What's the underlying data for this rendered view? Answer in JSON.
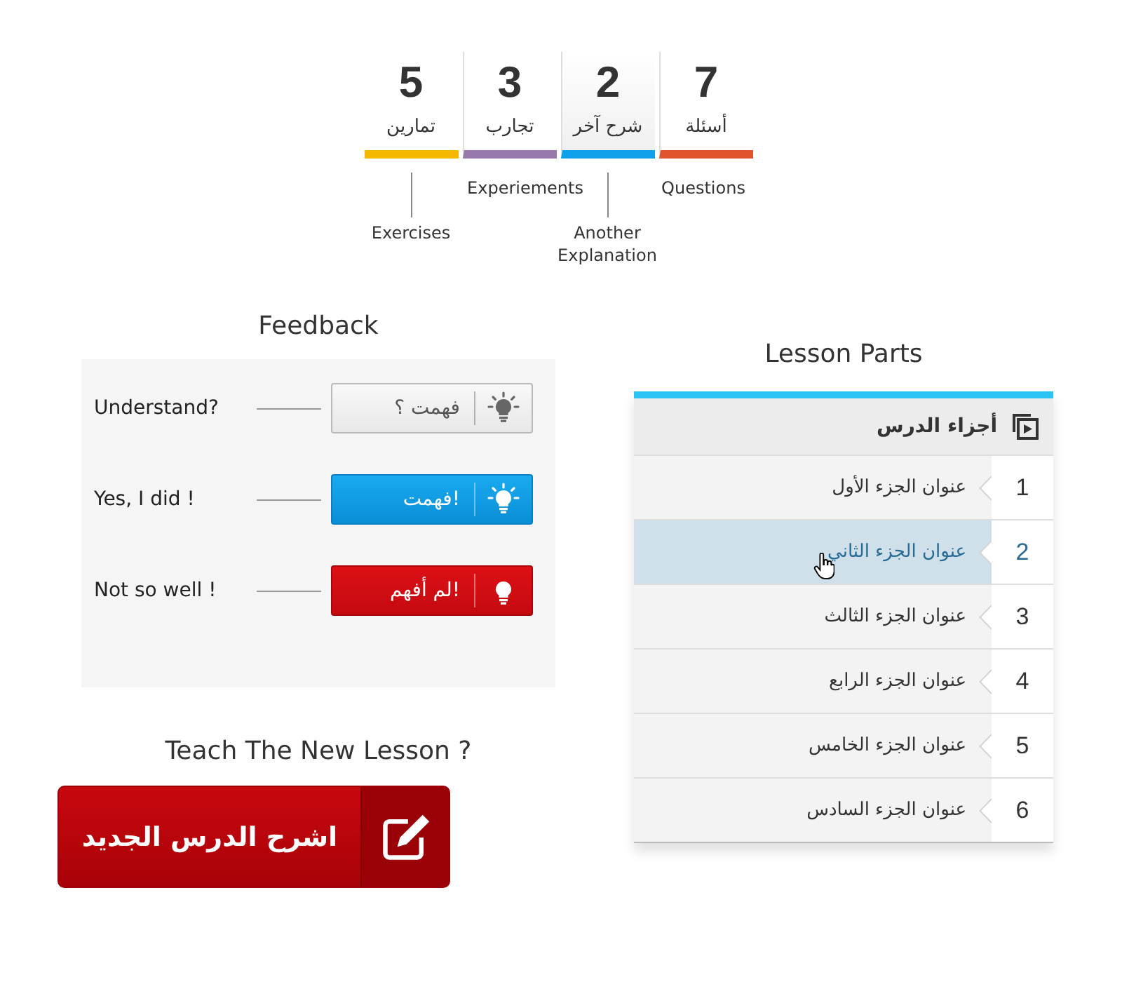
{
  "stats": [
    {
      "count": "7",
      "label": "أسئلة",
      "color": "#e0522e",
      "selected": false
    },
    {
      "count": "2",
      "label": "شرح آخر",
      "color": "#0ea0e8",
      "selected": true
    },
    {
      "count": "3",
      "label": "تجارب",
      "color": "#9779ab",
      "selected": false
    },
    {
      "count": "5",
      "label": "تمارين",
      "color": "#f5b800",
      "selected": false
    }
  ],
  "annotations": {
    "upper": [
      "Questions",
      "Experiements"
    ],
    "lower": [
      "Another Explanation",
      "Exercises"
    ]
  },
  "feedback": {
    "title": "Feedback",
    "rows": [
      {
        "caption": "Understand?",
        "button": "فهمت ؟",
        "kind": "neutral"
      },
      {
        "caption": "Yes, I did !",
        "button": "فهمت!",
        "kind": "positive"
      },
      {
        "caption": "Not so well !",
        "button": "لم أفهم!",
        "kind": "negative"
      }
    ]
  },
  "teach": {
    "title": "Teach The New Lesson ?",
    "button": "اشرح الدرس الجديد"
  },
  "lesson_parts": {
    "title": "Lesson Parts",
    "header": "أجزاء الدرس",
    "items": [
      {
        "number": "1",
        "title": "عنوان الجزء الأول",
        "selected": false
      },
      {
        "number": "2",
        "title": "عنوان الجزء الثاني",
        "selected": true
      },
      {
        "number": "3",
        "title": "عنوان الجزء الثالث",
        "selected": false
      },
      {
        "number": "4",
        "title": "عنوان الجزء الرابع",
        "selected": false
      },
      {
        "number": "5",
        "title": "عنوان الجزء الخامس",
        "selected": false
      },
      {
        "number": "6",
        "title": "عنوان الجزء السادس",
        "selected": false
      }
    ]
  }
}
